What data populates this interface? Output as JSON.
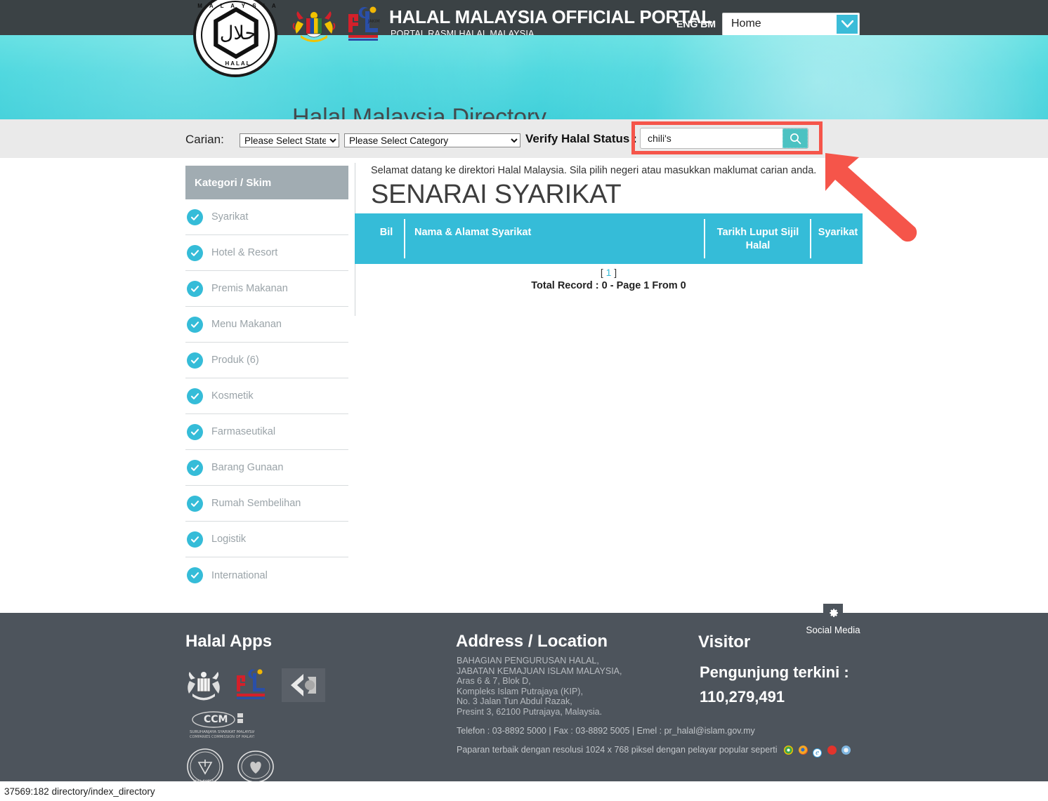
{
  "topbar": {
    "portal_title": "HALAL MALAYSIA OFFICIAL PORTAL",
    "portal_subtitle": "PORTAL RASMI HALAL MALAYSIA",
    "lang_eng": "ENG",
    "lang_bm": "BM",
    "lang_combined": "ENG BM",
    "nav_selected": "Home",
    "accent_color": "#3bbcd8",
    "bar_color": "#3b4245"
  },
  "seal": {
    "arabic": "حلال",
    "top_arc": "M A L A Y S I A",
    "bottom_word": "HALAL"
  },
  "banner": {
    "title": "Halal Malaysia Directory",
    "bg_color": "#35d2da"
  },
  "search": {
    "carian_label": "Carian:",
    "state_selected": "Please Select State",
    "state_options": [
      "Please Select State"
    ],
    "category_selected": "Please Select Category",
    "category_options": [
      "Please Select Category"
    ],
    "verify_label": "Verify Halal Status :",
    "query_value": "chili's",
    "query_placeholder": "",
    "search_icon": "search-icon",
    "highlight_color": "#f5554a",
    "button_color": "#4cc2c2"
  },
  "sidebar": {
    "header": "Kategori / Skim",
    "items": [
      {
        "label": "Syarikat"
      },
      {
        "label": "Hotel & Resort"
      },
      {
        "label": "Premis Makanan"
      },
      {
        "label": "Menu Makanan"
      },
      {
        "label": "Produk (6)"
      },
      {
        "label": "Kosmetik"
      },
      {
        "label": "Farmaseutikal"
      },
      {
        "label": "Barang Gunaan"
      },
      {
        "label": "Rumah Sembelihan"
      },
      {
        "label": "Logistik"
      },
      {
        "label": "International"
      }
    ]
  },
  "main": {
    "intro": "Selamat datang ke direktori Halal Malaysia. Sila pilih negeri atau masukkan maklumat carian anda.",
    "heading": "SENARAI SYARIKAT",
    "table_headers": {
      "bil": "Bil",
      "nama": "Nama & Alamat Syarikat",
      "tarikh": "Tarikh Luput Sijil Halal",
      "syarikat": "Syarikat"
    },
    "header_color": "#35bcd8",
    "rows": [],
    "pager_open": "[",
    "pager_page": "1",
    "pager_close": "]",
    "total_record": "Total Record : 0 - Page 1 From 0"
  },
  "annotation": {
    "arrow_color": "#f5554a",
    "arrow_name": "red-pointer-arrow"
  },
  "footer": {
    "apps_heading": "Halal Apps",
    "address_heading": "Address / Location",
    "visitor_heading": "Visitor",
    "address_lines": [
      "BAHAGIAN PENGURUSAN HALAL,",
      "JABATAN KEMAJUAN ISLAM MALAYSIA,",
      "Aras 6 & 7, Blok D,",
      "Kompleks Islam Putrajaya (KIP),",
      "No. 3 Jalan Tun Abdul Razak,",
      "Presint 3, 62100 Putrajaya, Malaysia."
    ],
    "contact_line": "Telefon : 03-8892 5000 | Fax : 03-8892 5005 | Emel : pr_halal@islam.gov.my",
    "resolution_line": "Paparan terbaik dengan resolusi 1024 x 768 piksel dengan pelayar popular seperti",
    "visitor_label": "Pengunjung terkini :",
    "visitor_count": "110,279,491",
    "social_label": "Social Media",
    "social_icon": "gear-icon",
    "bg_color": "#4d545c"
  },
  "statusbar": {
    "text": "37569:182 directory/index_directory"
  }
}
